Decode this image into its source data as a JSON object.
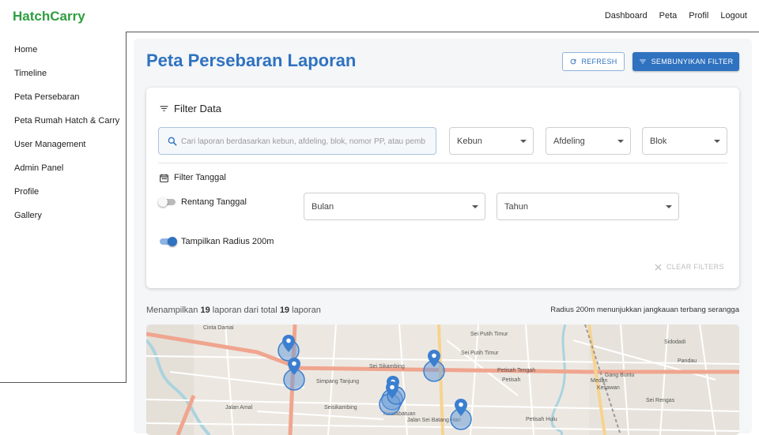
{
  "brand": "HatchCarry",
  "topnav": [
    "Dashboard",
    "Peta",
    "Profil",
    "Logout"
  ],
  "sidebar": [
    "Home",
    "Timeline",
    "Peta Persebaran",
    "Peta Rumah Hatch & Carry",
    "User Management",
    "Admin Panel",
    "Profile",
    "Gallery"
  ],
  "page": {
    "title": "Peta Persebaran Laporan",
    "refresh_label": "REFRESH",
    "hide_filter_label": "SEMBUNYIKAN FILTER"
  },
  "filter": {
    "title": "Filter Data",
    "search_placeholder": "Cari laporan berdasarkan kebun, afdeling, blok, nomor PP, atau pemb",
    "kebun": "Kebun",
    "afdeling": "Afdeling",
    "blok": "Blok",
    "date_title": "Filter Tanggal",
    "range_toggle_label": "Rentang Tanggal",
    "range_toggle_on": false,
    "bulan": "Bulan",
    "tahun": "Tahun",
    "radius_toggle_label": "Tampilkan Radius 200m",
    "radius_toggle_on": true,
    "clear_label": "CLEAR FILTERS"
  },
  "summary": {
    "prefix": "Menampilkan",
    "shown": "19",
    "middle": "laporan dari total",
    "total": "19",
    "suffix": "laporan",
    "radius_note": "Radius 200m menunjukkan jangkauan terbang serangga"
  },
  "map": {
    "labels": [
      "Cinta Damai",
      "Sei Sikambing",
      "Simpang Tanjung",
      "Seisikambing",
      "Sei Putih Timur",
      "Sei Putih Timur",
      "Petisah Tengah",
      "Petisah",
      "Gang Buntu",
      "Sidodadi",
      "Pandau",
      "Kesawan",
      "Medan",
      "Sei Rengas",
      "Jalan Sei Batang Hari",
      "Kwalabatuan",
      "Jalan Amal",
      "Petisah Hulu"
    ],
    "colors": {
      "marker": "#3b7fd0",
      "radius_fill": "#6f9fd8",
      "road_major": "#f0a58f",
      "road_minor": "#ffffff"
    }
  }
}
